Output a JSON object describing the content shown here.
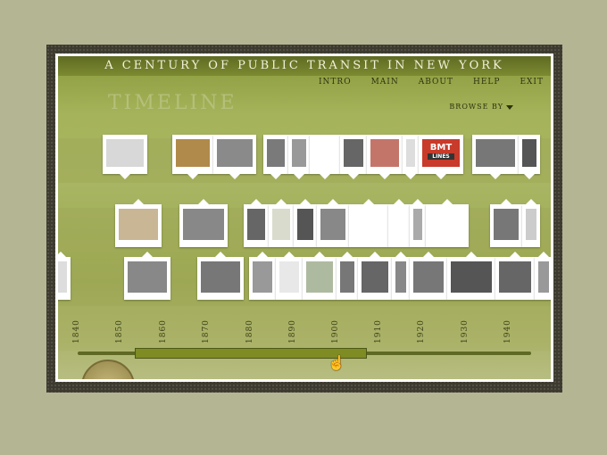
{
  "app": {
    "title": "A CENTURY OF PUBLIC TRANSIT IN NEW YORK",
    "section_title": "TIMELINE"
  },
  "nav": {
    "items": [
      "INTRO",
      "MAIN",
      "ABOUT",
      "HELP",
      "EXIT"
    ]
  },
  "browse": {
    "label": "BROWSE BY"
  },
  "badge": {
    "line1": "BMT",
    "line2": "LINES"
  },
  "years": [
    "1840",
    "1850",
    "1860",
    "1870",
    "1880",
    "1890",
    "1900",
    "1910",
    "1920",
    "1930",
    "1940"
  ],
  "slider": {
    "range_start_year": 1853,
    "range_end_year": 1909
  },
  "colors": {
    "accent": "#7f8c24",
    "background": "#b4b593",
    "frame": "#3d3a30"
  }
}
